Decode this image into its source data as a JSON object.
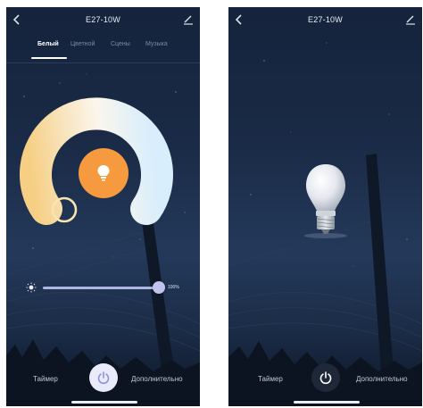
{
  "screens": [
    {
      "title": "E27-10W",
      "tabs": [
        {
          "label": "Белый",
          "active": true
        },
        {
          "label": "Цветной",
          "active": false
        },
        {
          "label": "Сцены",
          "active": false
        },
        {
          "label": "Музыка",
          "active": false
        }
      ],
      "brightness": {
        "value": 1.0,
        "label": "100%"
      },
      "footer": {
        "timer_label": "Таймер",
        "more_label": "Дополнительно"
      },
      "power_state": "on"
    },
    {
      "title": "E27-10W",
      "footer": {
        "timer_label": "Таймер",
        "more_label": "Дополнительно"
      },
      "power_state": "off"
    }
  ],
  "colors": {
    "warm_accent": "#f59a3e",
    "cool_white": "#e4f2fb",
    "warm_white": "#f5d79c",
    "slider": "#b4b8ea",
    "night_sky": "#1a2b47"
  },
  "icons": [
    "back-icon",
    "edit-icon",
    "bulb-icon",
    "sun-icon",
    "power-icon"
  ]
}
